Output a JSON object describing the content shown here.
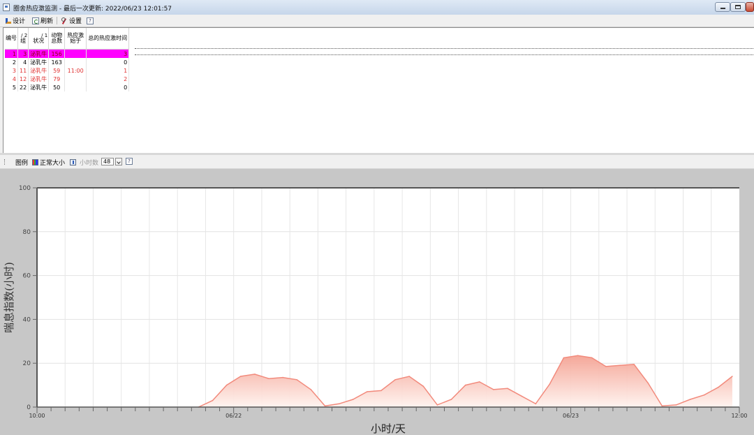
{
  "window": {
    "title": "圈舍热应激监测 - 最后一次更新: 2022/06/23 12:01:57"
  },
  "toolbar": {
    "design_label": "设计",
    "refresh_label": "刷新",
    "settings_label": "设置"
  },
  "table": {
    "headers": {
      "id": "编号",
      "group_sort": "/ 2",
      "group": "组",
      "status_sort": "/ 1",
      "status": "状况",
      "animals_line1": "动物",
      "animals_line2": "总数",
      "heat_line1": "热应激",
      "heat_line2": "始于",
      "total": "总的热应激时间"
    },
    "rows": [
      {
        "id": "1",
        "group": "3",
        "status": "泌乳牛",
        "animals": "156",
        "heat_start": "",
        "total": "3"
      },
      {
        "id": "2",
        "group": "4",
        "status": "泌乳牛",
        "animals": "163",
        "heat_start": "",
        "total": "0"
      },
      {
        "id": "3",
        "group": "11",
        "status": "泌乳牛",
        "animals": "59",
        "heat_start": "11:00",
        "total": "1"
      },
      {
        "id": "4",
        "group": "12",
        "status": "泌乳牛",
        "animals": "79",
        "heat_start": "",
        "total": "2"
      },
      {
        "id": "5",
        "group": "22",
        "status": "泌乳牛",
        "animals": "50",
        "heat_start": "",
        "total": "0"
      }
    ]
  },
  "chart_toolbar": {
    "legend_label": "图例",
    "normal_size_label": "正常大小",
    "hours_label": "小时数",
    "hours_value": "48"
  },
  "colors": {
    "selected_row": "#ff00ff",
    "alert_text": "#e03030",
    "area_line": "#f28a7c",
    "area_fill_top": "#f4a394"
  },
  "icons": [
    "app-icon",
    "design-icon",
    "refresh-icon",
    "settings-icon",
    "help-icon",
    "legend-icon",
    "normal-size-icon",
    "hours-icon",
    "help-icon",
    "minimize-icon",
    "maximize-icon",
    "close-icon"
  ],
  "chart_data": {
    "type": "area",
    "ylabel": "喘息指数(小时)",
    "xlabel": "小时/天",
    "ylim": [
      0,
      100
    ],
    "yticks": [
      0,
      20,
      40,
      60,
      80,
      100
    ],
    "xlim": [
      0,
      50
    ],
    "xtick_labels": [
      {
        "x": 0,
        "label": "10:00"
      },
      {
        "x": 14,
        "label": "06/22"
      },
      {
        "x": 38,
        "label": "06/23"
      },
      {
        "x": 50,
        "label": "12:00"
      }
    ],
    "grid": true,
    "series": [
      {
        "x": [
          11.5,
          12.5,
          13.5,
          14.5,
          15.5,
          16.5,
          17.5,
          18.5,
          19.5,
          20.5,
          21.5,
          22.5,
          23.5,
          24.5,
          25.5,
          26.5,
          27.5,
          28.5,
          29.5,
          30.5,
          31.5,
          32.5,
          33.5,
          34.5,
          35.5,
          36.5,
          37.5,
          38.5,
          39.5,
          40.5,
          41.5,
          42.5,
          43.5,
          44.5,
          45.5,
          46.5,
          47.5,
          48.5,
          49.5
        ],
        "values": [
          0,
          3,
          10,
          14,
          15,
          13,
          13.5,
          12.5,
          8,
          0.5,
          1.5,
          3.5,
          7,
          7.5,
          12.5,
          14,
          9.5,
          1,
          3.5,
          10,
          11.5,
          8,
          8.5,
          5,
          1.5,
          10.5,
          22.5,
          23.5,
          22.5,
          18.5,
          19,
          19.5,
          11,
          0.5,
          1,
          3.5,
          5.5,
          9,
          14
        ]
      }
    ]
  }
}
